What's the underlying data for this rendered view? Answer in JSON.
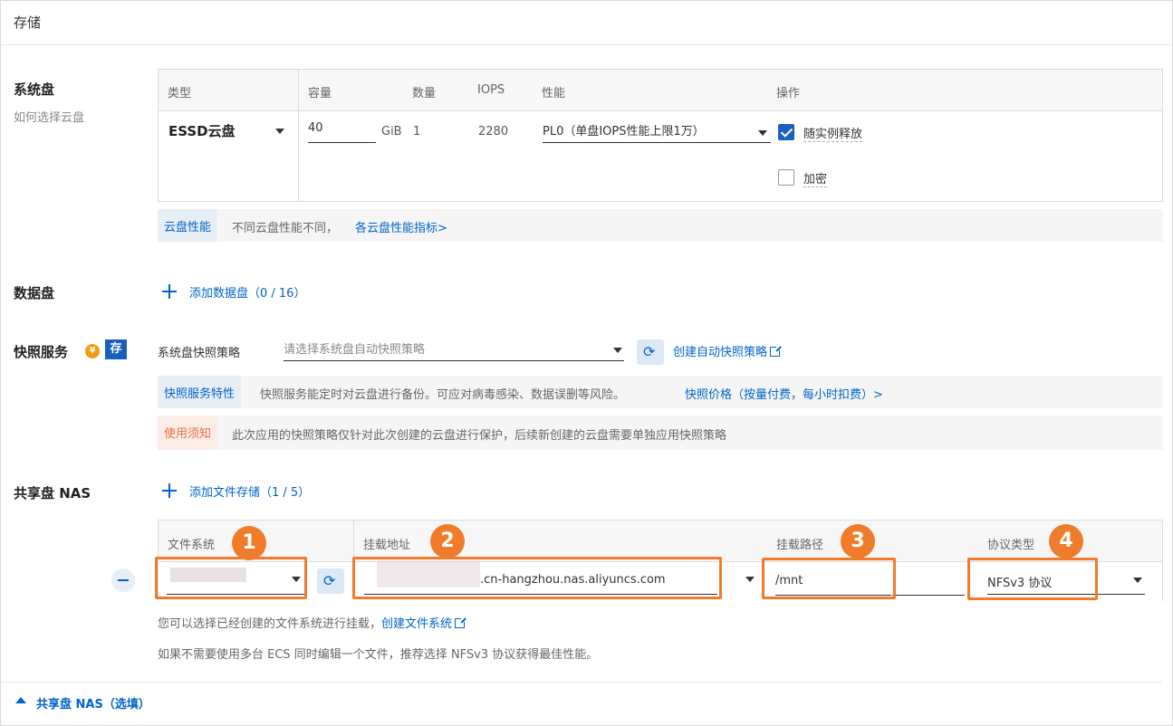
{
  "header": {
    "title": "存储"
  },
  "system_disk": {
    "title": "系统盘",
    "help_link": "如何选择云盘",
    "columns": [
      "类型",
      "容量",
      "数量",
      "IOPS",
      "性能",
      "操作"
    ],
    "type_value": "ESSD云盘",
    "capacity_value": "40",
    "capacity_unit": "GiB",
    "count": "1",
    "iops": "2280",
    "performance_value": "PL0（单盘IOPS性能上限1万）",
    "release_with_instance": {
      "label": "随实例释放",
      "checked": true
    },
    "encrypt": {
      "label": "加密",
      "checked": false
    },
    "info_tag": "云盘性能",
    "info_text": "不同云盘性能不同，",
    "info_link": "各云盘性能指标>"
  },
  "data_disk": {
    "title": "数据盘",
    "add_label": "添加数据盘（0 / 16）"
  },
  "snapshot": {
    "title": "快照服务",
    "yen_badge": "¥",
    "cun_badge": "存",
    "policy_label": "系统盘快照策略",
    "policy_placeholder": "请选择系统盘自动快照策略",
    "create_link": "创建自动快照策略",
    "feature_tag": "快照服务特性",
    "feature_text": "快照服务能定时对云盘进行备份。可应对病毒感染、数据误删等风险。",
    "price_link": "快照价格（按量付费，每小时扣费）>",
    "notice_tag": "使用须知",
    "notice_text": "此次应用的快照策略仅针对此次创建的云盘进行保护，后续新创建的云盘需要单独应用快照策略"
  },
  "nas": {
    "title": "共享盘 NAS",
    "add_label": "添加文件存储（1 / 5）",
    "columns": [
      "文件系统",
      "挂载地址",
      "挂载路径",
      "协议类型"
    ],
    "mount_address_suffix": ".cn-hangzhou.nas.aliyuncs.com",
    "mount_path": "/mnt",
    "protocol": "NFSv3 协议",
    "badges": [
      "1",
      "2",
      "3",
      "4"
    ],
    "hint_text": "您可以选择已经创建的文件系统进行挂载，",
    "hint_link": "创建文件系统",
    "tip_text": "如果不需要使用多台 ECS 同时编辑一个文件，推荐选择 NFSv3 协议获得最佳性能。",
    "collapse_label": "共享盘 NAS（选填）"
  },
  "colors": {
    "accent": "#0064c8",
    "highlight": "#f07c2b",
    "notice": "#e8704a"
  }
}
